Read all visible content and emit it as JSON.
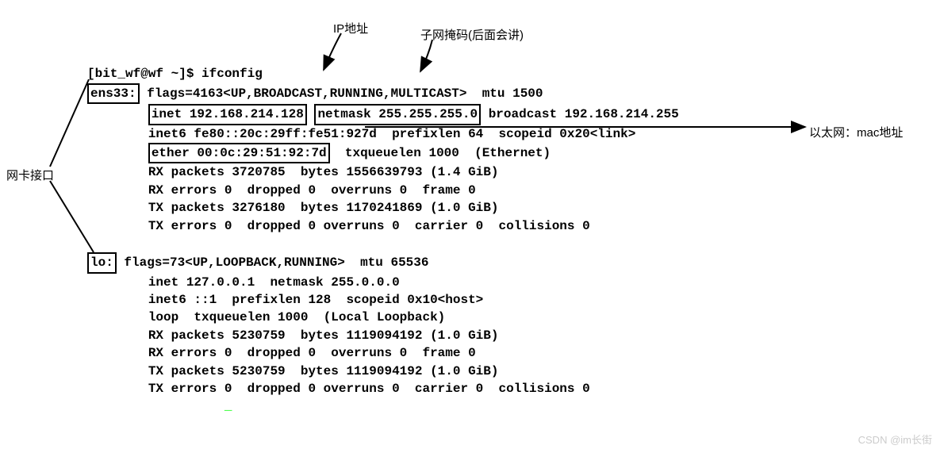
{
  "labels": {
    "ip_addr": "IP地址",
    "subnet_mask": "子网掩码(后面会讲)",
    "ethernet_mac": "以太网：mac地址",
    "nic_interface": "网卡接口"
  },
  "prompt": "[bit_wf@wf ~]$ ifconfig",
  "ens33": {
    "name": "ens33:",
    "flags": "flags=4163<UP,BROADCAST,RUNNING,MULTICAST>  mtu 1500",
    "inet": "inet 192.168.214.128",
    "netmask": "netmask 255.255.255.0",
    "broadcast": " broadcast 192.168.214.255",
    "inet6": "inet6 fe80::20c:29ff:fe51:927d  prefixlen 64  scopeid 0x20<link>",
    "ether": "ether 00:0c:29:51:92:7d",
    "ether_rest": "  txqueuelen 1000  (Ethernet)",
    "rx_packets": "RX packets 3720785  bytes 1556639793 (1.4 GiB)",
    "rx_errors": "RX errors 0  dropped 0  overruns 0  frame 0",
    "tx_packets": "TX packets 3276180  bytes 1170241869 (1.0 GiB)",
    "tx_errors": "TX errors 0  dropped 0 overruns 0  carrier 0  collisions 0"
  },
  "lo": {
    "name": "lo:",
    "flags": " flags=73<UP,LOOPBACK,RUNNING>  mtu 65536",
    "inet": "inet 127.0.0.1  netmask 255.0.0.0",
    "inet6": "inet6 ::1  prefixlen 128  scopeid 0x10<host>",
    "loop": "loop  txqueuelen 1000  (Local Loopback)",
    "rx_packets": "RX packets 5230759  bytes 1119094192 (1.0 GiB)",
    "rx_errors": "RX errors 0  dropped 0  overruns 0  frame 0",
    "tx_packets": "TX packets 5230759  bytes 1119094192 (1.0 GiB)",
    "tx_errors": "TX errors 0  dropped 0 overruns 0  carrier 0  collisions 0"
  },
  "cursor": "_",
  "watermark": "CSDN @im长街"
}
